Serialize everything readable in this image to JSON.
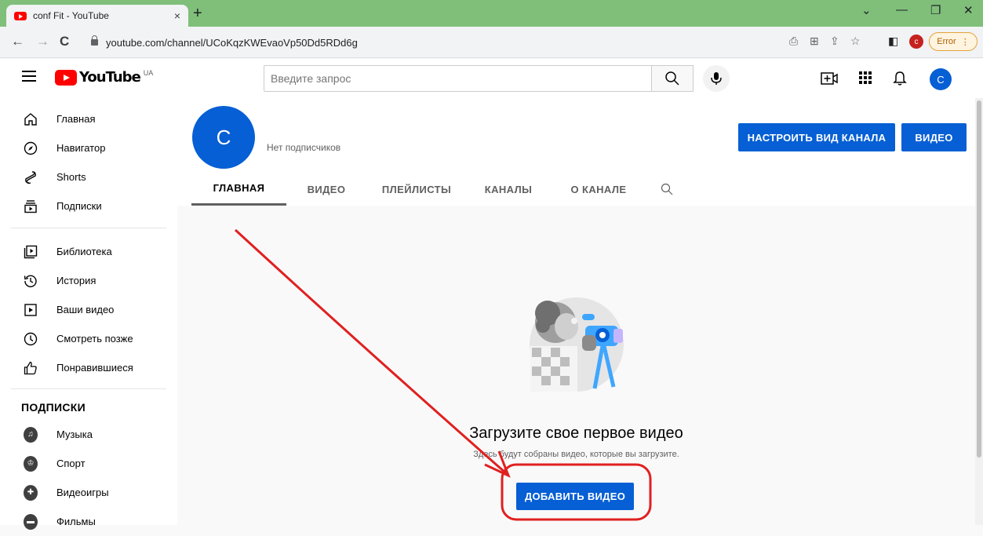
{
  "browser": {
    "tab_title": "conf Fit - YouTube",
    "tab_close": "×",
    "new_tab": "+",
    "url": "youtube.com/channel/UCoKqzKWEvaoVp50Dd5RDd6g",
    "profile_letter": "c",
    "error_label": "Error",
    "minimize": "—",
    "restore": "❐",
    "close": "✕",
    "dropdown": "⌄"
  },
  "header": {
    "logo_text": "YouTube",
    "country_code": "UA",
    "search_placeholder": "Введите запрос",
    "user_letter": "C"
  },
  "sidebar": {
    "main": [
      "Главная",
      "Навигатор",
      "Shorts",
      "Подписки"
    ],
    "library": [
      "Библиотека",
      "История",
      "Ваши видео",
      "Смотреть позже",
      "Понравившиеся"
    ],
    "subscriptions_heading": "ПОДПИСКИ",
    "subscriptions": [
      "Музыка",
      "Спорт",
      "Видеоигры",
      "Фильмы"
    ]
  },
  "channel": {
    "avatar_letter": "C",
    "subscribers": "Нет подписчиков",
    "customize_button": "НАСТРОИТЬ ВИД КАНАЛА",
    "video_button": "ВИДЕО",
    "tabs": [
      "ГЛАВНАЯ",
      "ВИДЕО",
      "ПЛЕЙЛИСТЫ",
      "КАНАЛЫ",
      "О КАНАЛЕ"
    ]
  },
  "empty_state": {
    "title": "Загрузите свое первое видео",
    "subtitle": "Здесь будут собраны видео, которые вы загрузите.",
    "add_button": "ДОБАВИТЬ ВИДЕО"
  },
  "colors": {
    "accent": "#065fd4",
    "annotation": "#e02020",
    "tabbar": "#7fbf7a"
  }
}
